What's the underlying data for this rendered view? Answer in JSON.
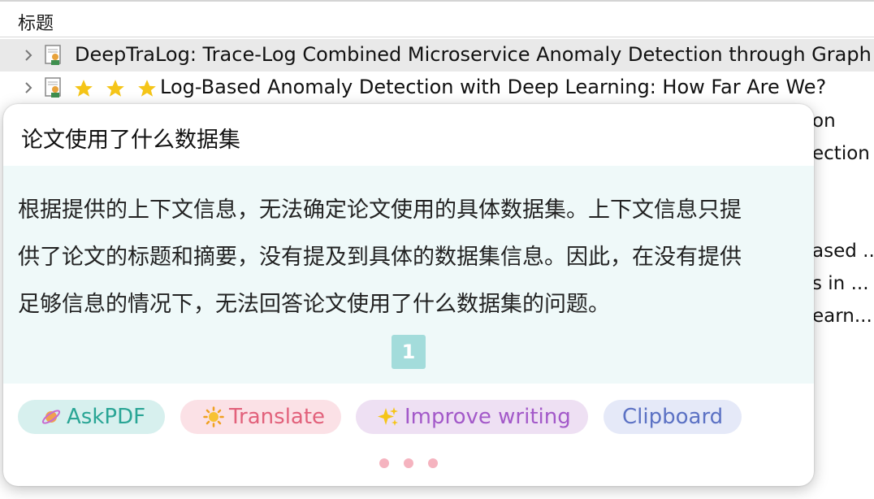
{
  "header": {
    "title": "标题"
  },
  "rows": [
    {
      "title": "DeepTraLog: Trace-Log Combined Microservice Anomaly Detection through Graph-..."
    },
    {
      "title": "Log-Based Anomaly Detection with Deep Learning: How Far Are We?",
      "stars": 3
    }
  ],
  "background_fragments": [
    "on",
    "ection",
    "ased ...",
    "s in ...",
    "earn..."
  ],
  "popup": {
    "question": "论文使用了什么数据集",
    "answer_lines": [
      "根据提供的上下文信息，无法确定论文使用的具体数据集。上下文信息只提",
      "供了论文的标题和摘要，没有提及到具体的数据集信息。因此，在没有提供",
      "足够信息的情况下，无法回答论文使用了什么数据集的问题。"
    ],
    "page_ref": "1",
    "buttons": [
      {
        "label": "AskPDF",
        "icon": "planet-icon"
      },
      {
        "label": "Translate",
        "icon": "sun-icon"
      },
      {
        "label": "Improve writing",
        "icon": "sparkles-icon"
      },
      {
        "label": "Clipboard"
      }
    ]
  },
  "colors": {
    "selected_row": "#e9e9e9",
    "answer_bg": "#eff9f9",
    "badge": "#a3dcdb",
    "dots": "#f5b3bf"
  }
}
